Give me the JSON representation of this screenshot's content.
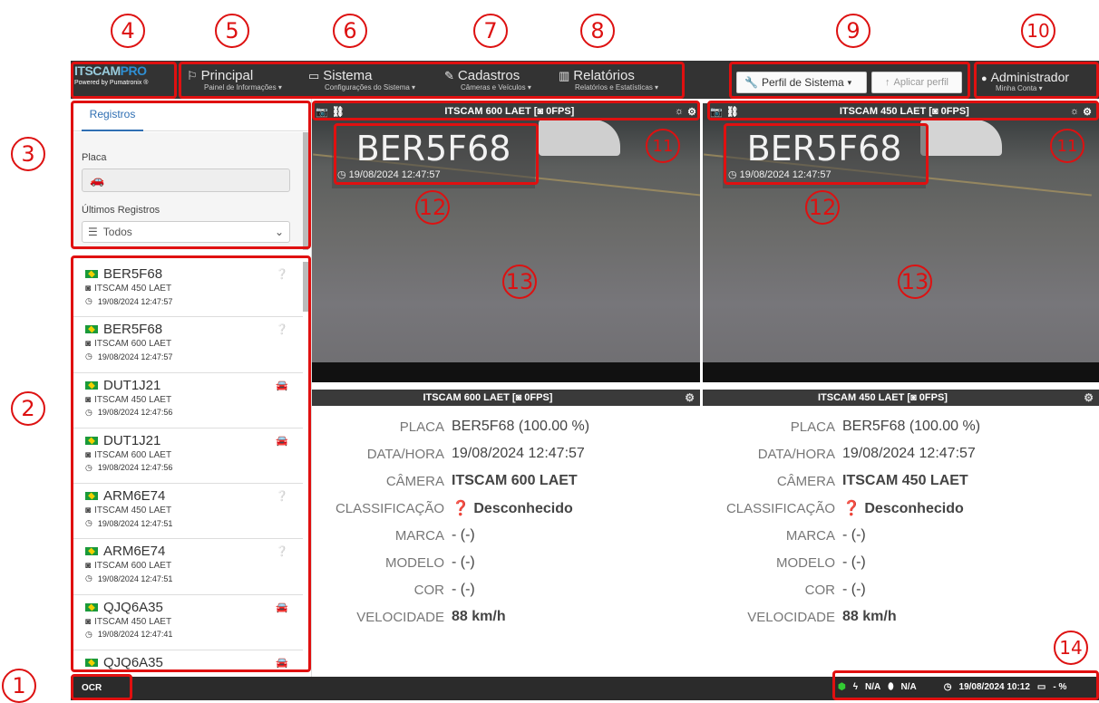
{
  "callouts": [
    "1",
    "2",
    "3",
    "4",
    "5",
    "6",
    "7",
    "8",
    "9",
    "10",
    "11",
    "11",
    "12",
    "12",
    "13",
    "13",
    "14"
  ],
  "logo": {
    "text_a": "ITSCAM",
    "text_b": "PRO",
    "tagline": "Powered by Pumatronix ®"
  },
  "nav": {
    "principal": {
      "label": "Principal",
      "sub": "Painel de Informações ▾"
    },
    "sistema": {
      "label": "Sistema",
      "sub": "Configurações do Sistema ▾"
    },
    "cadastros": {
      "label": "Cadastros",
      "sub": "Câmeras e Veículos ▾"
    },
    "relatorios": {
      "label": "Relatórios",
      "sub": "Relatórios e Estatísticas ▾"
    },
    "profile_select": "Perfil de Sistema",
    "apply_profile": "Aplicar perfil",
    "user": {
      "name": "Administrador",
      "sub": "Minha Conta ▾"
    }
  },
  "sidebar": {
    "tab": "Registros",
    "placa_label": "Placa",
    "ultimos_label": "Últimos Registros",
    "ultimos_value": "Todos",
    "records": [
      {
        "plate": "BER5F68",
        "camera": "ITSCAM 450 LAET",
        "time": "19/08/2024 12:47:57",
        "cls": "?"
      },
      {
        "plate": "BER5F68",
        "camera": "ITSCAM 600 LAET",
        "time": "19/08/2024 12:47:57",
        "cls": "?"
      },
      {
        "plate": "DUT1J21",
        "camera": "ITSCAM 450 LAET",
        "time": "19/08/2024 12:47:56",
        "cls": "car"
      },
      {
        "plate": "DUT1J21",
        "camera": "ITSCAM 600 LAET",
        "time": "19/08/2024 12:47:56",
        "cls": "car"
      },
      {
        "plate": "ARM6E74",
        "camera": "ITSCAM 450 LAET",
        "time": "19/08/2024 12:47:51",
        "cls": "?"
      },
      {
        "plate": "ARM6E74",
        "camera": "ITSCAM 600 LAET",
        "time": "19/08/2024 12:47:51",
        "cls": "?"
      },
      {
        "plate": "QJQ6A35",
        "camera": "ITSCAM 450 LAET",
        "time": "19/08/2024 12:47:41",
        "cls": "car"
      },
      {
        "plate": "QJQ6A35",
        "camera": "",
        "time": "",
        "cls": "car"
      }
    ]
  },
  "cameras": [
    {
      "header": "ITSCAM 600 LAET [",
      "fps": "0FPS]",
      "plate": "BER5F68",
      "datetime": "19/08/2024 12:47:57",
      "info": {
        "placa": "BER5F68 (100.00 %)",
        "datahora": "19/08/2024 12:47:57",
        "camera": "ITSCAM 600 LAET",
        "classificacao": "Desconhecido",
        "marca": "- (-)",
        "modelo": "- (-)",
        "cor": "- (-)",
        "velocidade": "88 km/h"
      }
    },
    {
      "header": "ITSCAM 450 LAET [",
      "fps": "0FPS]",
      "plate": "BER5F68",
      "datetime": "19/08/2024 12:47:57",
      "info": {
        "placa": "BER5F68 (100.00 %)",
        "datahora": "19/08/2024 12:47:57",
        "camera": "ITSCAM 450 LAET",
        "classificacao": "Desconhecido",
        "marca": "- (-)",
        "modelo": "- (-)",
        "cor": "- (-)",
        "velocidade": "88 km/h"
      }
    }
  ],
  "info_labels": {
    "placa": "PLACA",
    "datahora": "DATA/HORA",
    "camera": "CÂMERA",
    "classificacao": "CLASSIFICAÇÃO",
    "marca": "MARCA",
    "modelo": "MODELO",
    "cor": "COR",
    "velocidade": "VELOCIDADE"
  },
  "statusbar": {
    "ocr": "OCR",
    "power": "N/A",
    "temp": "N/A",
    "datetime": "19/08/2024 10:12",
    "disk": "- %"
  },
  "colors": {
    "accent": "#2f6fb3",
    "callout": "#dd1111",
    "navbar": "#333333"
  }
}
